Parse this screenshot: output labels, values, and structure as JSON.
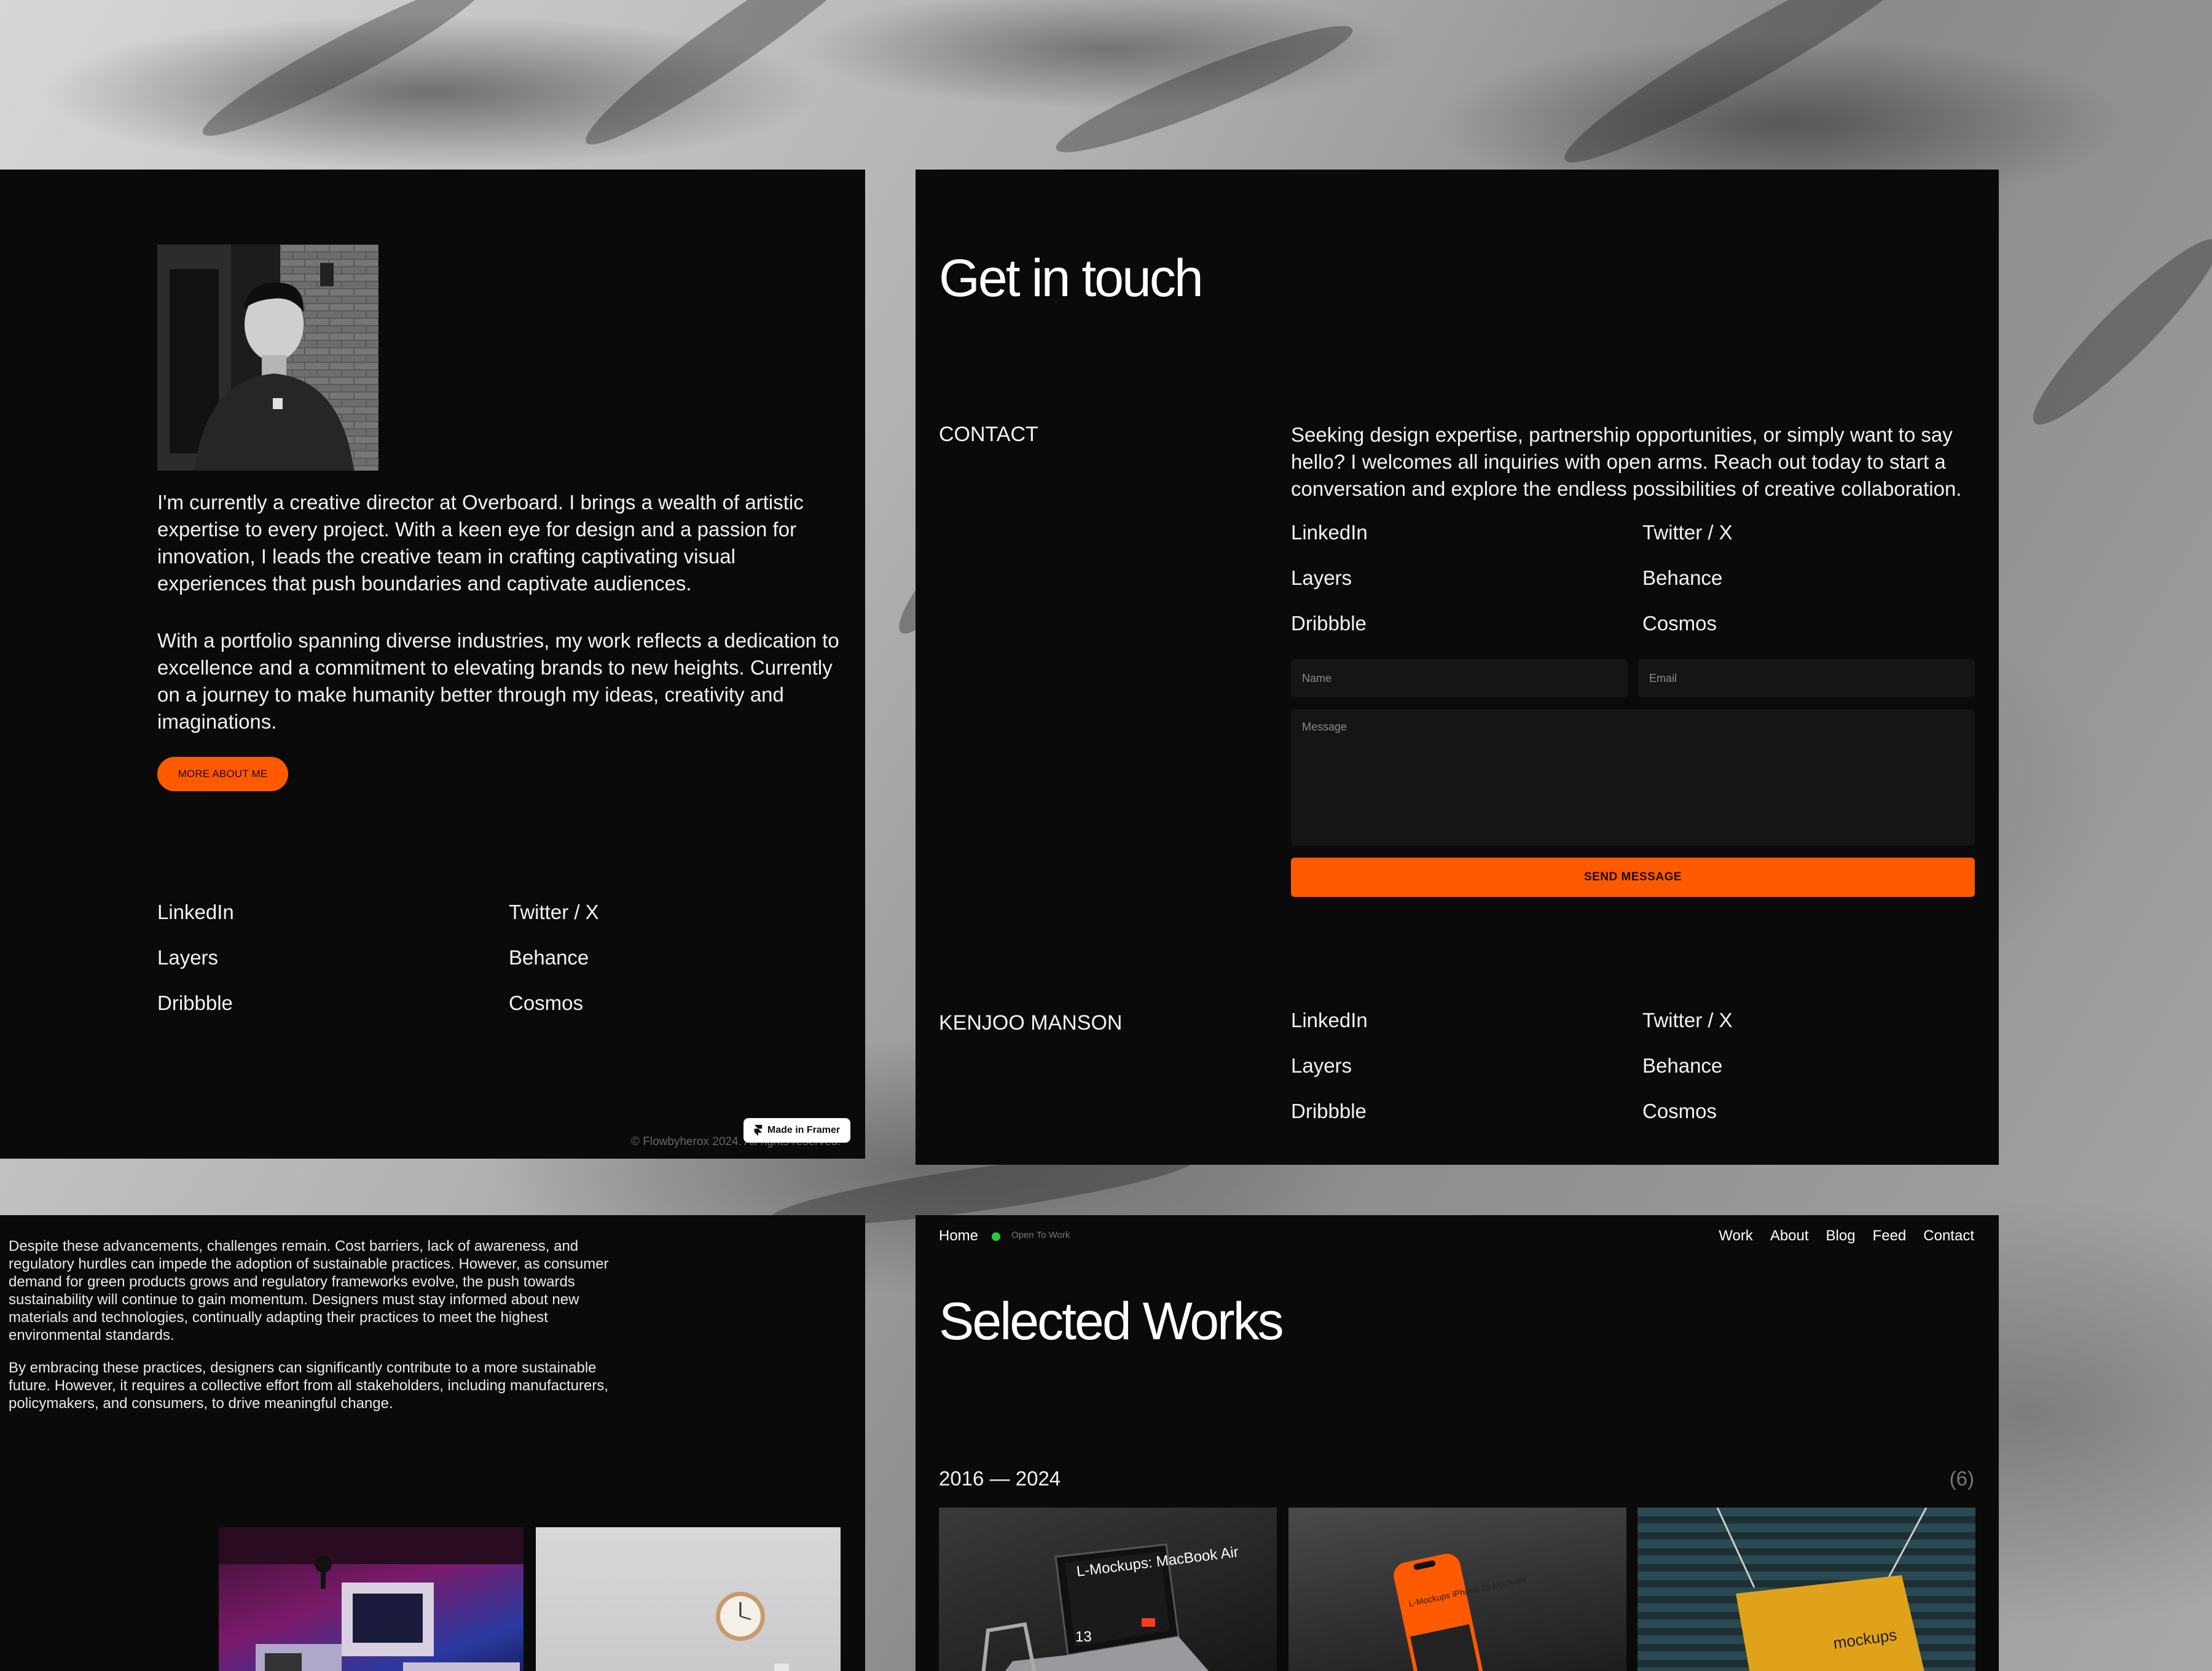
{
  "about": {
    "bio_paragraph_1": "I'm currently a creative director at Overboard. I brings a wealth of artistic expertise to every project. With a keen eye for design and a passion for innovation, I leads the creative team in crafting captivating visual experiences that push boundaries and captivate audiences.",
    "bio_paragraph_2": "With a portfolio spanning diverse industries, my work reflects a dedication to excellence and a commitment to elevating brands to new heights. Currently on a journey to make humanity better through my ideas, creativity and imaginations.",
    "cta_label": "MORE ABOUT ME",
    "social_links": [
      "LinkedIn",
      "Twitter / X",
      "Layers",
      "Behance",
      "Dribbble",
      "Cosmos"
    ],
    "copyright": "© Flowbyherox 2024. All rights reserved.",
    "framer_badge": "Made in Framer"
  },
  "contact": {
    "title": "Get in touch",
    "section_label": "CONTACT",
    "intro": "Seeking design expertise, partnership opportunities, or simply want to say hello? I welcomes all inquiries with open arms. Reach out today to start a conversation and explore the endless possibilities of creative collaboration.",
    "social_links": [
      "LinkedIn",
      "Twitter / X",
      "Layers",
      "Behance",
      "Dribbble",
      "Cosmos"
    ],
    "form": {
      "name_placeholder": "Name",
      "email_placeholder": "Email",
      "message_placeholder": "Message",
      "submit_label": "SEND MESSAGE"
    },
    "footer_name": "KENJOO MANSON",
    "footer_social_links": [
      "LinkedIn",
      "Twitter / X",
      "Layers",
      "Behance",
      "Dribbble",
      "Cosmos"
    ]
  },
  "article": {
    "paragraph_1": "Despite these advancements, challenges remain. Cost barriers, lack of awareness, and regulatory hurdles can impede the adoption of sustainable practices. However, as consumer demand for green products grows and regulatory frameworks evolve, the push towards sustainability will continue to gain momentum. Designers must stay informed about new materials and technologies, continually adapting their practices to meet the highest environmental standards.",
    "paragraph_2": "By embracing these practices, designers can significantly contribute to a more sustainable future. However, it requires a collective effort from all stakeholders, including manufacturers, policymakers, and consumers, to drive meaningful change."
  },
  "works": {
    "nav_home": "Home",
    "status": "Open To Work",
    "nav_links": [
      "Work",
      "About",
      "Blog",
      "Feed",
      "Contact"
    ],
    "title": "Selected Works",
    "years": "2016 — 2024",
    "count": "(6)",
    "card_1_text": "L-Mockups: MacBook Air",
    "card_1_number": "13",
    "card_2_text": "L-Mockups iPhone 15 Mockups",
    "card_3_text": "mockups"
  },
  "colors": {
    "accent": "#ff5a00",
    "panel": "#0a0a0a",
    "field": "#151515",
    "status_green": "#27c93f"
  }
}
